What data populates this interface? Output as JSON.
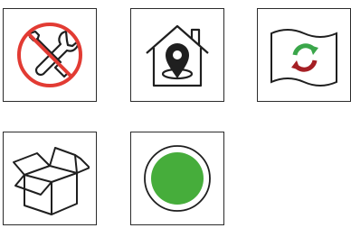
{
  "tiles": [
    {
      "icon": "no-tools-icon"
    },
    {
      "icon": "home-location-icon"
    },
    {
      "icon": "recycle-flag-icon"
    },
    {
      "icon": "open-box-icon"
    },
    {
      "icon": "green-dot-icon"
    }
  ],
  "colors": {
    "stroke": "#1f1f1f",
    "prohibited_red": "#e23b33",
    "recycle_green": "#3aa64a",
    "recycle_red": "#a51f24",
    "dot_green": "#46ad3b"
  }
}
